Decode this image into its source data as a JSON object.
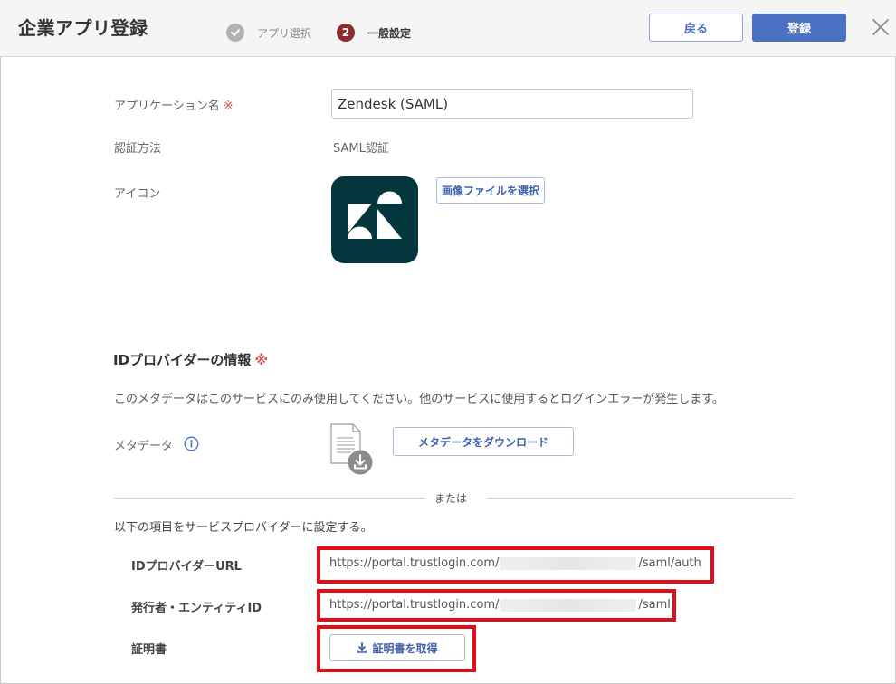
{
  "header": {
    "title": "企業アプリ登録",
    "steps": [
      {
        "number": "✓",
        "label": "アプリ選択",
        "state": "done"
      },
      {
        "number": "2",
        "label": "一般設定",
        "state": "active"
      }
    ],
    "back_label": "戻る",
    "register_label": "登録",
    "close_icon": "close-icon"
  },
  "form": {
    "app_name_label": "アプリケーション名",
    "required_mark": "※",
    "app_name_value": "Zendesk (SAML)",
    "auth_label": "認証方法",
    "auth_value": "SAML認証",
    "icon_label": "アイコン",
    "choose_image_label": "画像ファイルを選択"
  },
  "idp": {
    "section_title": "IDプロバイダーの情報",
    "required_mark": "※",
    "description": "このメタデータはこのサービスにのみ使用してください。他のサービスに使用するとログインエラーが発生します。",
    "metadata_label": "メタデータ",
    "download_label": "メタデータをダウンロード",
    "or_label": "または",
    "sub_title": "以下の項目をサービスプロバイダーに設定する。",
    "url_label": "IDプロバイダーURL",
    "url_prefix": "https://portal.trustlogin.com/",
    "url_suffix": "/saml/auth",
    "issuer_label": "発行者・エンティティID",
    "issuer_prefix": "https://portal.trustlogin.com/",
    "issuer_suffix": "/saml",
    "cert_label": "証明書",
    "cert_button_label": "証明書を取得"
  },
  "colors": {
    "accent": "#4b71c2",
    "step_active": "#8b2a2f",
    "highlight": "#e0101a",
    "zendesk_bg": "#03363d"
  }
}
